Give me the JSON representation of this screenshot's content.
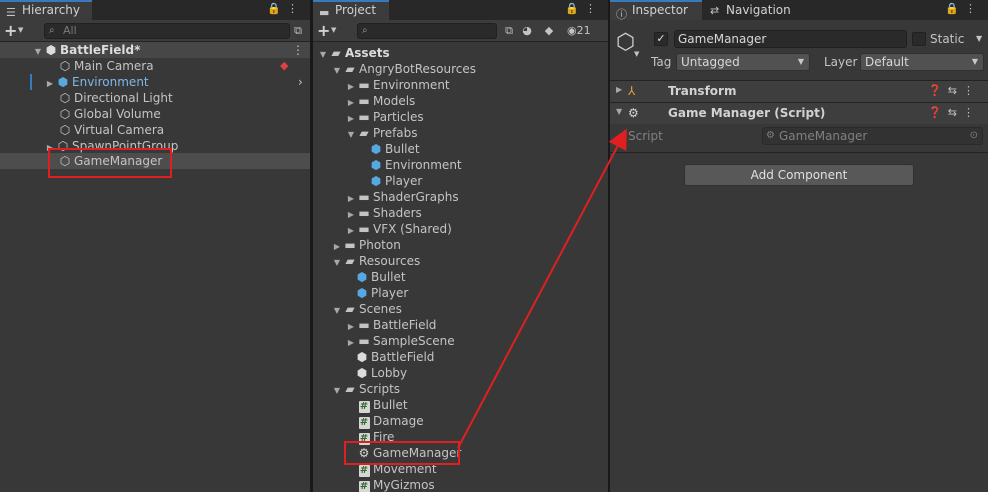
{
  "hierarchy": {
    "tab": "Hierarchy",
    "search_placeholder": "All",
    "scene": "BattleField*",
    "items": [
      {
        "label": "Main Camera"
      },
      {
        "label": "Environment"
      },
      {
        "label": "Directional Light"
      },
      {
        "label": "Global Volume"
      },
      {
        "label": "Virtual Camera"
      },
      {
        "label": "SpawnPointGroup"
      },
      {
        "label": "GameManager"
      }
    ]
  },
  "project": {
    "tab": "Project",
    "hidden_count": "21",
    "tree": [
      {
        "label": "Assets"
      },
      {
        "label": "AngryBotResources"
      },
      {
        "label": "Environment"
      },
      {
        "label": "Models"
      },
      {
        "label": "Particles"
      },
      {
        "label": "Prefabs"
      },
      {
        "label": "Bullet"
      },
      {
        "label": "Environment"
      },
      {
        "label": "Player"
      },
      {
        "label": "ShaderGraphs"
      },
      {
        "label": "Shaders"
      },
      {
        "label": "VFX (Shared)"
      },
      {
        "label": "Photon"
      },
      {
        "label": "Resources"
      },
      {
        "label": "Bullet"
      },
      {
        "label": "Player"
      },
      {
        "label": "Scenes"
      },
      {
        "label": "BattleField"
      },
      {
        "label": "SampleScene"
      },
      {
        "label": "BattleField"
      },
      {
        "label": "Lobby"
      },
      {
        "label": "Scripts"
      },
      {
        "label": "Bullet"
      },
      {
        "label": "Damage"
      },
      {
        "label": "Fire"
      },
      {
        "label": "GameManager"
      },
      {
        "label": "Movement"
      },
      {
        "label": "MyGizmos"
      }
    ]
  },
  "inspector": {
    "tab": "Inspector",
    "nav_tab": "Navigation",
    "object_name": "GameManager",
    "static_label": "Static",
    "tag_label": "Tag",
    "tag_value": "Untagged",
    "layer_label": "Layer",
    "layer_value": "Default",
    "transform_title": "Transform",
    "script_component_title": "Game Manager (Script)",
    "script_label": "Script",
    "script_value": "GameManager",
    "add_component": "Add Component"
  },
  "colors": {
    "accent": "#3a79bb",
    "highlight": "#e02020",
    "prefab_blue": "#58a8e0"
  }
}
